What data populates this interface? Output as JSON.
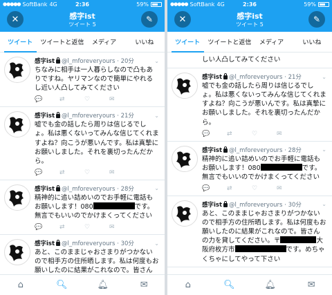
{
  "status": {
    "carrier": "SoftBank",
    "network": "4G",
    "time": "2:36",
    "battery": "59%"
  },
  "header": {
    "title": "感字ist",
    "subtitle": "ツイート 5",
    "close_icon": "close-icon",
    "compose_icon": "compose-icon"
  },
  "tabs": [
    {
      "label": "ツイート"
    },
    {
      "label": "ツイートと返信"
    },
    {
      "label": "メディア"
    },
    {
      "label": "いいね"
    }
  ],
  "profile": {
    "name": "感字ist",
    "handle": "@l_mforeveryours"
  },
  "left": {
    "tweets": [
      {
        "time": "20分",
        "text": "ちなみに相手は一人暮らしなので凸もありですね。ヤリマンなので簡単にやれるし近い人凸してみてください"
      },
      {
        "time": "21分",
        "text": "嘘でも金の話したら周りは信じるでしょ。私は悪くないってみんな信じてくれますよね？向こうが悪いんです。私は真摯にお願いしました。それを裏切ったんだから。"
      },
      {
        "time": "28分",
        "text_a": "精神的に追い詰めいのでお手軽に電話もお願いします！080",
        "text_b": "です。無言でもいいのでかけまくってください"
      },
      {
        "time": "30分",
        "text_a": "あと、このままじゃおさまりがつかないので相手方の住所晒します。私は何度もお願いしたのに結果がこれなので。皆さんの力を貸してください。〒",
        "text_b": ""
      }
    ]
  },
  "right": {
    "partial_text": "しい人凸してみてください",
    "tweets": [
      {
        "time": "21分",
        "text": "嘘でも金の話したら周りは信じるでしょ。私は悪くないってみんな信じてくれますよね？向こうが悪いんです。私は真摯にお願いしました。それを裏切ったんだから。"
      },
      {
        "time": "28分",
        "text_a": "精神的に追い詰めいのでお手軽に電話もお願いします！080",
        "text_b": "です。無言でもいいのでかけまくってください"
      },
      {
        "time": "30分",
        "text_a": "あと、このままじゃおさまりがつかないので相手方の住所晒します。私は何度もお願いしたのに結果がこれなので。皆さんの力を貸してください。〒",
        "text_b": "大阪府枚方市",
        "text_c": "です。めちゃくちゃにしてやって下さい"
      }
    ]
  },
  "actions": {
    "reply_icon": "reply-icon",
    "retweet_icon": "retweet-icon",
    "like_icon": "heart-icon",
    "share_icon": "share-icon"
  },
  "nav": {
    "home_icon": "home-icon",
    "search_icon": "search-icon",
    "notifications_icon": "bell-icon",
    "messages_icon": "mail-icon"
  },
  "colors": {
    "accent": "#1da1f2",
    "text": "#14171a",
    "muted": "#657786"
  }
}
